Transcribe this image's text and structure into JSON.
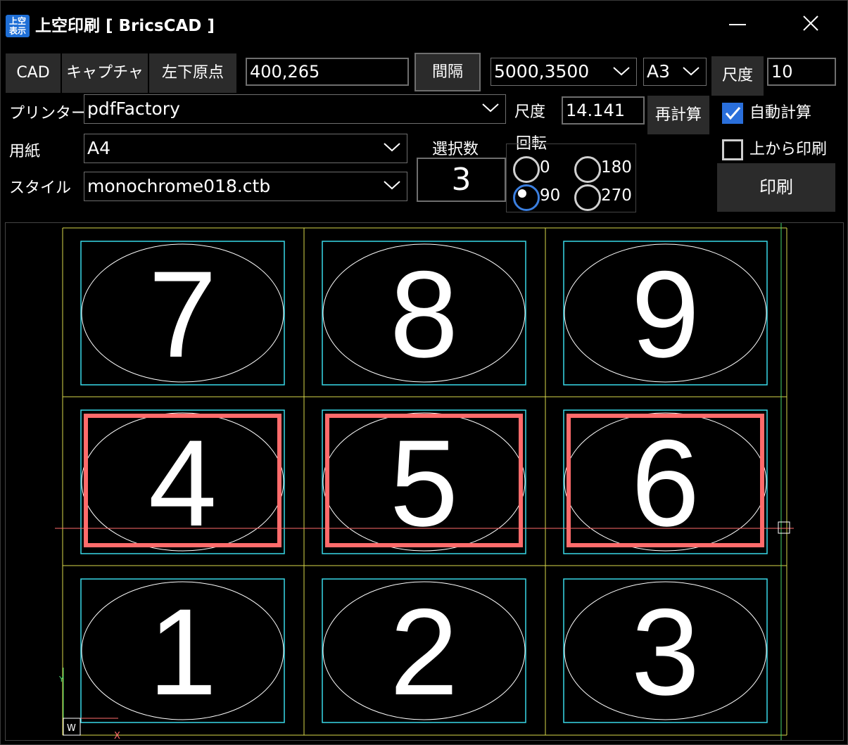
{
  "window": {
    "icon_text_top": "上空",
    "icon_text_bottom": "表示",
    "title": "上空印刷 [ BricsCAD ]",
    "minimize_glyph": "—",
    "close_glyph": "✕"
  },
  "toolbar": {
    "cad_label": "CAD",
    "capture_label": "キャプチャ",
    "origin_label": "左下原点",
    "origin_value": "400,265",
    "spacing_label": "間隔",
    "spacing_value": "5000,3500",
    "sheet_size": "A3",
    "scale_button_label": "尺度",
    "scale_value": "10"
  },
  "printer": {
    "label": "プリンター",
    "value": "pdfFactory"
  },
  "paper": {
    "label": "用紙",
    "value": "A4"
  },
  "style": {
    "label": "スタイル",
    "value": "monochrome018.ctb"
  },
  "scale_calc": {
    "label": "尺度",
    "value": "14.141",
    "recalc_label": "再計算"
  },
  "auto_calc": {
    "label": "自動計算",
    "checked": true
  },
  "print_from_top": {
    "label": "上から印刷",
    "checked": false
  },
  "selection": {
    "label": "選択数",
    "count": "3"
  },
  "rotation": {
    "label": "回転",
    "options": [
      "0",
      "180",
      "90",
      "270"
    ],
    "selected": "90"
  },
  "print_button_label": "印刷",
  "preview": {
    "cells": [
      {
        "number": "7",
        "selected": false
      },
      {
        "number": "8",
        "selected": false
      },
      {
        "number": "9",
        "selected": false
      },
      {
        "number": "4",
        "selected": true
      },
      {
        "number": "5",
        "selected": true
      },
      {
        "number": "6",
        "selected": true
      },
      {
        "number": "1",
        "selected": false
      },
      {
        "number": "2",
        "selected": false
      },
      {
        "number": "3",
        "selected": false
      }
    ],
    "ucs_w_label": "W",
    "ucs_x_label": "X",
    "ucs_y_label": "Y",
    "colors": {
      "grid": "#d8d84a",
      "frame": "#38d9e8",
      "selection": "#ff6b6b",
      "ellipse": "#ffffff",
      "crosshair": "#ff6b6b"
    }
  }
}
